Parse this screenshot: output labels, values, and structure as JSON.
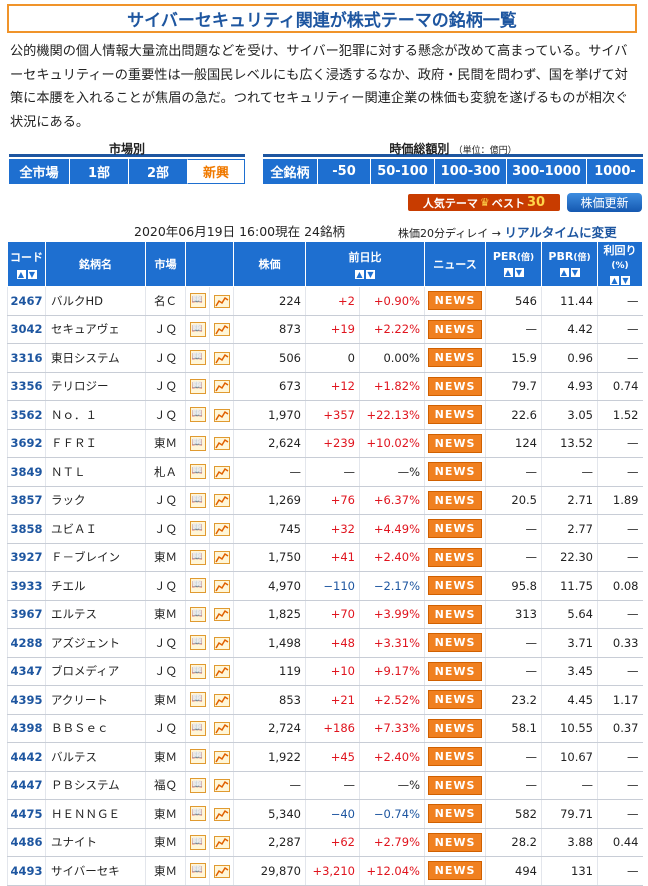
{
  "title": "サイバーセキュリティ関連が株式テーマの銘柄一覧",
  "intro": "公的機関の個人情報大量流出問題などを受け、サイバー犯罪に対する懸念が改めて高まっている。サイバーセキュリティーの重要性は一般国民レベルにも広く浸透するなか、政府・民間を問わず、国を挙げて対策に本腰を入れることが焦眉の急だ。つれてセキュリティー関連企業の株価も変貌を遂げるものが相次ぐ状況にある。",
  "market_filter": {
    "label": "市場別",
    "options": [
      "全市場",
      "1部",
      "2部",
      "新興"
    ],
    "selected": "全市場"
  },
  "cap_filter": {
    "label": "時価総額別",
    "unit": "（単位：億円）",
    "options": [
      "全銘柄",
      "-50",
      "50-100",
      "100-300",
      "300-1000",
      "1000-"
    ],
    "selected": "全銘柄"
  },
  "ranking_badge": {
    "text": "人気テーマ",
    "suffix": "ベスト",
    "num": "30"
  },
  "update_button": "株価更新",
  "asof": "2020年06月19日  16:00現在  24銘柄",
  "delay_note": "株価20分ディレイ →",
  "realtime_link": "リアルタイムに変更",
  "columns": {
    "code": "コード",
    "name": "銘柄名",
    "market": "市場",
    "price": "株価",
    "change": "前日比",
    "news": "ニュース",
    "per": "PER",
    "per_unit": "(倍)",
    "pbr": "PBR",
    "pbr_unit": "(倍)",
    "yield": "利回り",
    "yield_unit": "(%)"
  },
  "news_label": "NEWS",
  "icons": {
    "book": "book-icon",
    "chart": "chart-icon"
  },
  "colors": {
    "header": "#1e6fd0",
    "up": "#e0141e",
    "down": "#1e56a0",
    "news": "#f08020"
  },
  "rows": [
    {
      "code": "2467",
      "name": "バルクHD",
      "market": "名Ｃ",
      "price": "224",
      "chg": "+2",
      "pct": "+0.90%",
      "dir": "up",
      "per": "546",
      "pbr": "11.44",
      "yld": "—"
    },
    {
      "code": "3042",
      "name": "セキュアヴェ",
      "market": "ＪＱ",
      "price": "873",
      "chg": "+19",
      "pct": "+2.22%",
      "dir": "up",
      "per": "—",
      "pbr": "4.42",
      "yld": "—"
    },
    {
      "code": "3316",
      "name": "東日システム",
      "market": "ＪＱ",
      "price": "506",
      "chg": "0",
      "pct": "0.00%",
      "dir": "flat",
      "per": "15.9",
      "pbr": "0.96",
      "yld": "—"
    },
    {
      "code": "3356",
      "name": "テリロジー",
      "market": "ＪＱ",
      "price": "673",
      "chg": "+12",
      "pct": "+1.82%",
      "dir": "up",
      "per": "79.7",
      "pbr": "4.93",
      "yld": "0.74"
    },
    {
      "code": "3562",
      "name": "Ｎｏ．１",
      "market": "ＪＱ",
      "price": "1,970",
      "chg": "+357",
      "pct": "+22.13%",
      "dir": "up",
      "per": "22.6",
      "pbr": "3.05",
      "yld": "1.52"
    },
    {
      "code": "3692",
      "name": "ＦＦＲＩ",
      "market": "東Ｍ",
      "price": "2,624",
      "chg": "+239",
      "pct": "+10.02%",
      "dir": "up",
      "per": "124",
      "pbr": "13.52",
      "yld": "—"
    },
    {
      "code": "3849",
      "name": "ＮＴＬ",
      "market": "札Ａ",
      "price": "—",
      "chg": "—",
      "pct": "—%",
      "dir": "flat",
      "per": "—",
      "pbr": "—",
      "yld": "—"
    },
    {
      "code": "3857",
      "name": "ラック",
      "market": "ＪＱ",
      "price": "1,269",
      "chg": "+76",
      "pct": "+6.37%",
      "dir": "up",
      "per": "20.5",
      "pbr": "2.71",
      "yld": "1.89"
    },
    {
      "code": "3858",
      "name": "ユビＡＩ",
      "market": "ＪＱ",
      "price": "745",
      "chg": "+32",
      "pct": "+4.49%",
      "dir": "up",
      "per": "—",
      "pbr": "2.77",
      "yld": "—"
    },
    {
      "code": "3927",
      "name": "Ｆ－ブレイン",
      "market": "東Ｍ",
      "price": "1,750",
      "chg": "+41",
      "pct": "+2.40%",
      "dir": "up",
      "per": "—",
      "pbr": "22.30",
      "yld": "—"
    },
    {
      "code": "3933",
      "name": "チエル",
      "market": "ＪＱ",
      "price": "4,970",
      "chg": "−110",
      "pct": "−2.17%",
      "dir": "down",
      "per": "95.8",
      "pbr": "11.75",
      "yld": "0.08"
    },
    {
      "code": "3967",
      "name": "エルテス",
      "market": "東Ｍ",
      "price": "1,825",
      "chg": "+70",
      "pct": "+3.99%",
      "dir": "up",
      "per": "313",
      "pbr": "5.64",
      "yld": "—"
    },
    {
      "code": "4288",
      "name": "アズジェント",
      "market": "ＪＱ",
      "price": "1,498",
      "chg": "+48",
      "pct": "+3.31%",
      "dir": "up",
      "per": "—",
      "pbr": "3.71",
      "yld": "0.33"
    },
    {
      "code": "4347",
      "name": "ブロメディア",
      "market": "ＪＱ",
      "price": "119",
      "chg": "+10",
      "pct": "+9.17%",
      "dir": "up",
      "per": "—",
      "pbr": "3.45",
      "yld": "—"
    },
    {
      "code": "4395",
      "name": "アクリート",
      "market": "東Ｍ",
      "price": "853",
      "chg": "+21",
      "pct": "+2.52%",
      "dir": "up",
      "per": "23.2",
      "pbr": "4.45",
      "yld": "1.17"
    },
    {
      "code": "4398",
      "name": "ＢＢＳｅｃ",
      "market": "ＪＱ",
      "price": "2,724",
      "chg": "+186",
      "pct": "+7.33%",
      "dir": "up",
      "per": "58.1",
      "pbr": "10.55",
      "yld": "0.37"
    },
    {
      "code": "4442",
      "name": "バルテス",
      "market": "東Ｍ",
      "price": "1,922",
      "chg": "+45",
      "pct": "+2.40%",
      "dir": "up",
      "per": "—",
      "pbr": "10.67",
      "yld": "—"
    },
    {
      "code": "4447",
      "name": "ＰＢシステム",
      "market": "福Ｑ",
      "price": "—",
      "chg": "—",
      "pct": "—%",
      "dir": "flat",
      "per": "—",
      "pbr": "—",
      "yld": "—"
    },
    {
      "code": "4475",
      "name": "ＨＥＮＮＧＥ",
      "market": "東Ｍ",
      "price": "5,340",
      "chg": "−40",
      "pct": "−0.74%",
      "dir": "down",
      "per": "582",
      "pbr": "79.71",
      "yld": "—"
    },
    {
      "code": "4486",
      "name": "ユナイト",
      "market": "東Ｍ",
      "price": "2,287",
      "chg": "+62",
      "pct": "+2.79%",
      "dir": "up",
      "per": "28.2",
      "pbr": "3.88",
      "yld": "0.44"
    },
    {
      "code": "4493",
      "name": "サイバーセキ",
      "market": "東Ｍ",
      "price": "29,870",
      "chg": "+3,210",
      "pct": "+12.04%",
      "dir": "up",
      "per": "494",
      "pbr": "131",
      "yld": "—"
    }
  ]
}
